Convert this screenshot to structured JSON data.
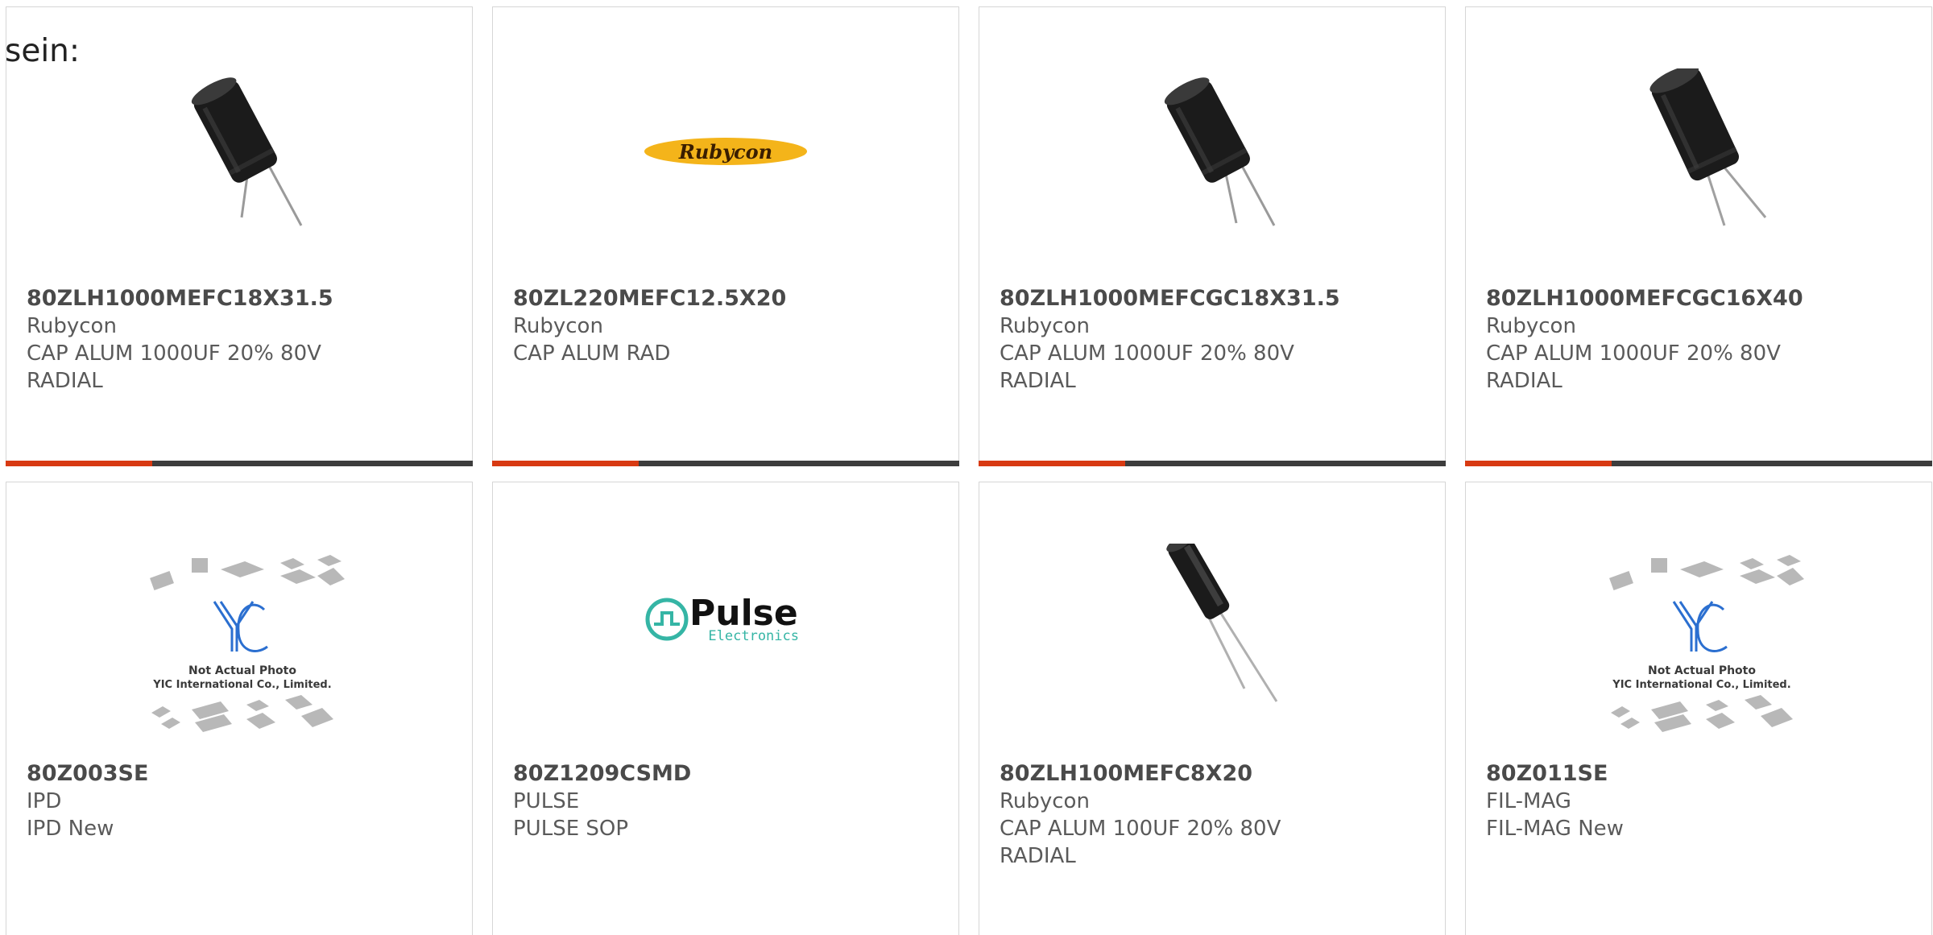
{
  "intro_text": "sein:",
  "colors": {
    "accent": "#d83a12",
    "bar": "#3d3d3d",
    "border": "#d6d6d6",
    "capacitor": "#1b1b1b",
    "rubycon_badge": "#f4b41a",
    "pulse_teal": "#35b5a5"
  },
  "products": [
    {
      "part_number": "80ZLH1000MEFC18X31.5",
      "manufacturer": "Rubycon",
      "description": "CAP ALUM 1000UF 20% 80V RADIAL",
      "image": "capacitor-photo"
    },
    {
      "part_number": "80ZL220MEFC12.5X20",
      "manufacturer": "Rubycon",
      "description": "CAP ALUM RAD",
      "image": "rubycon-logo",
      "logo_text": "Rubycon"
    },
    {
      "part_number": "80ZLH1000MEFCGC18X31.5",
      "manufacturer": "Rubycon",
      "description": "CAP ALUM 1000UF 20% 80V RADIAL",
      "image": "capacitor-photo"
    },
    {
      "part_number": "80ZLH1000MEFCGC16X40",
      "manufacturer": "Rubycon",
      "description": "CAP ALUM 1000UF 20% 80V RADIAL",
      "image": "capacitor-photo"
    },
    {
      "part_number": "80Z003SE",
      "manufacturer": "IPD",
      "description": "IPD New",
      "image": "not-actual-photo",
      "logo_text": "YIC",
      "caption_line1": "Not Actual Photo",
      "caption_line2": "YIC International Co., Limited."
    },
    {
      "part_number": "80Z1209CSMD",
      "manufacturer": "PULSE",
      "description": "PULSE SOP",
      "image": "pulse-logo",
      "logo_text": "Pulse",
      "logo_subtext": "Electronics"
    },
    {
      "part_number": "80ZLH100MEFC8X20",
      "manufacturer": "Rubycon",
      "description": "CAP ALUM 100UF 20% 80V RADIAL",
      "image": "capacitor-photo-slim"
    },
    {
      "part_number": "80Z011SE",
      "manufacturer": "FIL-MAG",
      "description": "FIL-MAG New",
      "image": "not-actual-photo",
      "logo_text": "YIC",
      "caption_line1": "Not Actual Photo",
      "caption_line2": "YIC International Co., Limited."
    }
  ]
}
